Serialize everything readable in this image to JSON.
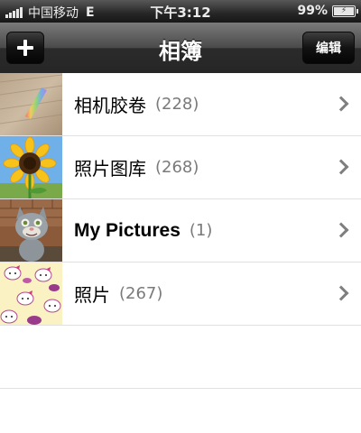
{
  "status_bar": {
    "carrier": "中国移动",
    "network": "E",
    "time": "下午3:12",
    "battery_percent": "99%",
    "battery_level": 0.99
  },
  "nav": {
    "title": "相簿",
    "add_icon": "plus-icon",
    "edit_label": "编辑"
  },
  "albums": [
    {
      "name": "相机胶卷",
      "count": "(228)",
      "thumbnail": "wood-rainbow-photo"
    },
    {
      "name": "照片图库",
      "count": "(268)",
      "thumbnail": "sunflower-photo"
    },
    {
      "name": "My Pictures",
      "count": "(1)",
      "thumbnail": "tom-cat-photo"
    },
    {
      "name": "照片",
      "count": "(267)",
      "thumbnail": "hello-kitty-pattern"
    }
  ],
  "icons": {
    "row_chevron": "chevron-right-icon"
  },
  "colors": {
    "nav_bar": "#2b2b2b",
    "count_text": "#7a7a7a",
    "separator": "#e0e0e0"
  }
}
